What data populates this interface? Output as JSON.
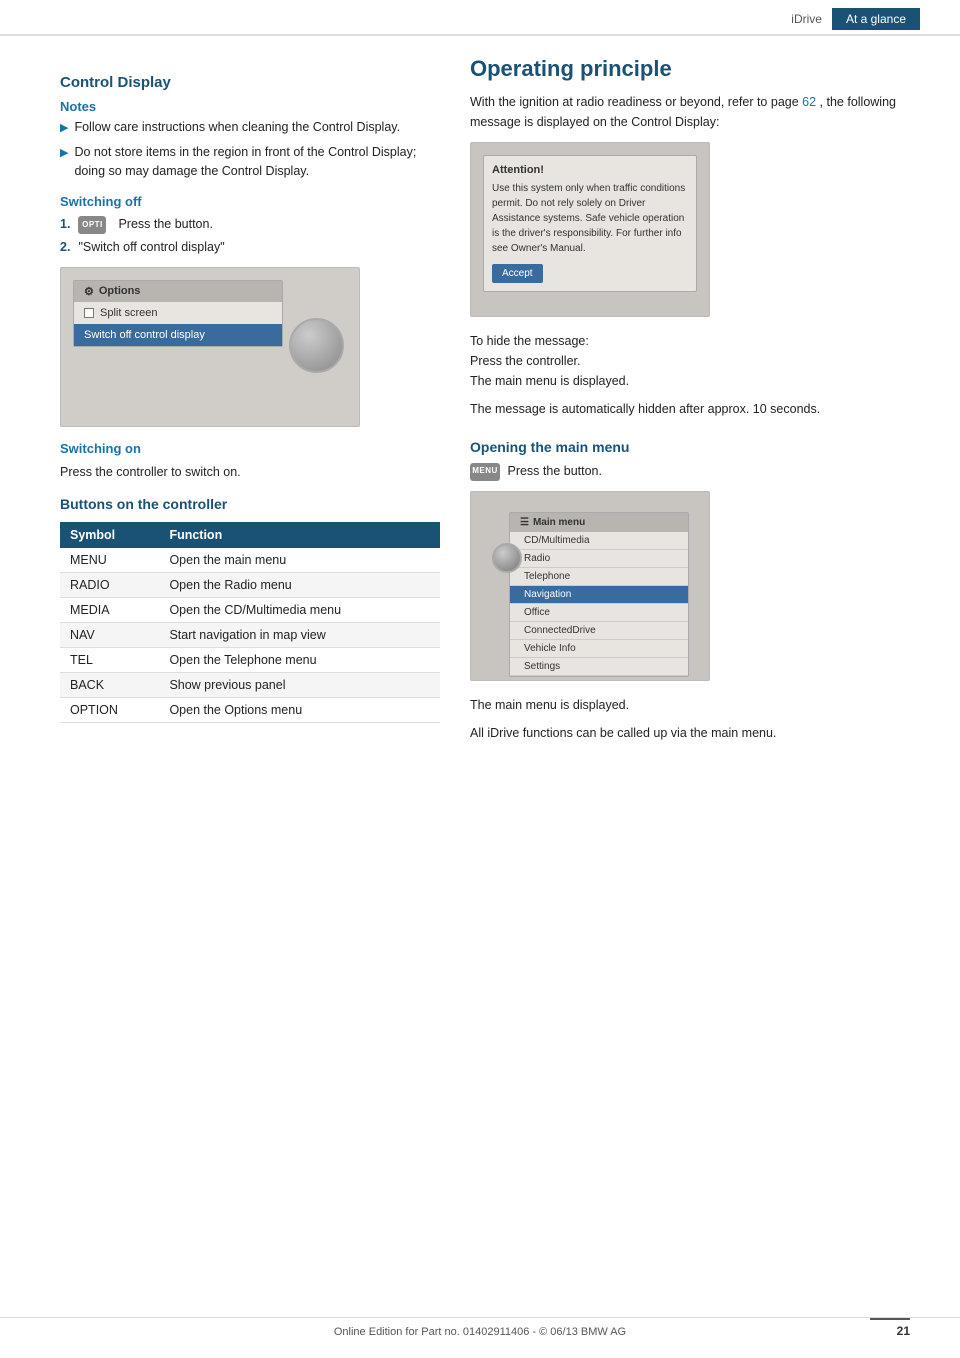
{
  "header": {
    "tab_idrive": "iDrive",
    "tab_ataglance": "At a glance"
  },
  "left": {
    "control_display_title": "Control Display",
    "notes_label": "Notes",
    "notes": [
      "Follow care instructions when cleaning the Control Display.",
      "Do not store items in the region in front of the Control Display; doing so may damage the Control Display."
    ],
    "switching_off_title": "Switching off",
    "steps": [
      {
        "num": "1.",
        "icon_label": "OPTI",
        "text": "Press the button."
      },
      {
        "num": "2.",
        "text": "\"Switch off control display\""
      }
    ],
    "options_menu": {
      "header": "Options",
      "items": [
        {
          "label": "Split screen",
          "highlighted": false
        },
        {
          "label": "Switch off control display",
          "highlighted": true
        }
      ]
    },
    "switching_on_title": "Switching on",
    "switching_on_text": "Press the controller to switch on.",
    "buttons_title": "Buttons on the controller",
    "table": {
      "headers": [
        "Symbol",
        "Function"
      ],
      "rows": [
        {
          "symbol": "MENU",
          "function": "Open the main menu"
        },
        {
          "symbol": "RADIO",
          "function": "Open the Radio menu"
        },
        {
          "symbol": "MEDIA",
          "function": "Open the CD/Multimedia menu"
        },
        {
          "symbol": "NAV",
          "function": "Start navigation in map view"
        },
        {
          "symbol": "TEL",
          "function": "Open the Telephone menu"
        },
        {
          "symbol": "BACK",
          "function": "Show previous panel"
        },
        {
          "symbol": "OPTION",
          "function": "Open the Options menu"
        }
      ]
    }
  },
  "right": {
    "operating_title": "Operating principle",
    "intro_text": "With the ignition at radio readiness or beyond, refer to page",
    "page_ref": "62",
    "intro_text2": ", the following message is displayed on the Control Display:",
    "attention_box": {
      "title": "Attention!",
      "body": "Use this system only when traffic conditions permit. Do not rely solely on Driver Assistance systems. Safe vehicle operation is the driver's responsibility. For further info see Owner's Manual."
    },
    "accept_btn": "Accept",
    "hide_message_text": "To hide the message:\nPress the controller.\nThe main menu is displayed.",
    "auto_hide_text": "The message is automatically hidden after approx. 10 seconds.",
    "opening_main_menu_title": "Opening the main menu",
    "menu_icon_label": "MENU",
    "press_button_text": "Press the button.",
    "main_menu": {
      "header": "Main menu",
      "items": [
        {
          "label": "CD/Multimedia",
          "active": false
        },
        {
          "label": "Radio",
          "active": false
        },
        {
          "label": "Telephone",
          "active": false
        },
        {
          "label": "Navigation",
          "active": true
        },
        {
          "label": "Office",
          "active": false
        },
        {
          "label": "ConnectedDrive",
          "active": false
        },
        {
          "label": "Vehicle Info",
          "active": false
        },
        {
          "label": "Settings",
          "active": false
        }
      ]
    },
    "main_menu_displayed": "The main menu is displayed.",
    "all_functions_text": "All iDrive functions can be called up via the main menu."
  },
  "footer": {
    "text": "Online Edition for Part no. 01402911406 - © 06/13 BMW AG",
    "page_number": "21"
  }
}
